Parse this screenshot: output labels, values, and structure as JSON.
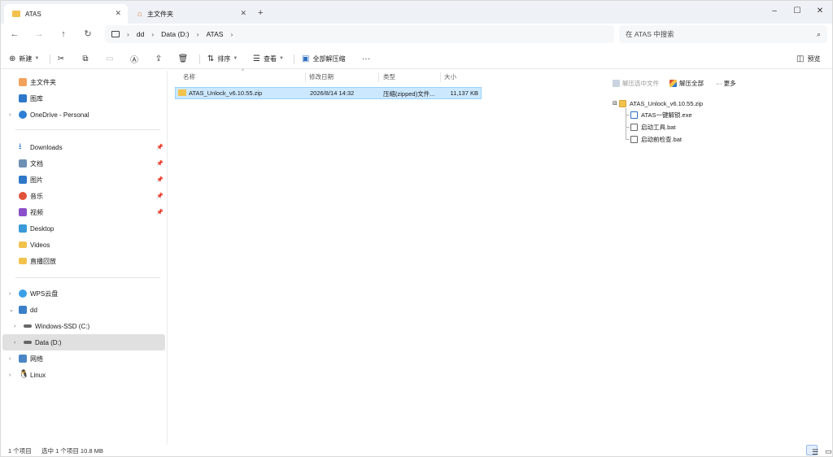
{
  "tabs": [
    {
      "label": "ATAS",
      "icon": "folder-icon",
      "active": true
    },
    {
      "label": "主文件夹",
      "icon": "home-icon",
      "active": false
    }
  ],
  "window_controls": {
    "minimize": "–",
    "maximize": "☐",
    "close": "✕"
  },
  "nav": {
    "back": "←",
    "forward": "→",
    "up": "↑",
    "refresh": "↻"
  },
  "breadcrumb": [
    "dd",
    "Data (D:)",
    "ATAS"
  ],
  "search": {
    "placeholder": "在 ATAS 中搜索"
  },
  "toolbar": {
    "new_label": "新建",
    "sort_label": "排序",
    "view_label": "查看",
    "extract_all_label": "全部解压缩",
    "more_label": "···",
    "preview_label": "预览"
  },
  "sidebar": {
    "items": [
      {
        "label": "主文件夹",
        "icon": "home-icon"
      },
      {
        "label": "图库",
        "icon": "gallery-icon"
      },
      {
        "label": "OneDrive - Personal",
        "icon": "cloud-icon"
      },
      {
        "label": "Downloads",
        "icon": "download-icon"
      },
      {
        "label": "文档",
        "icon": "document-icon"
      },
      {
        "label": "图片",
        "icon": "picture-icon"
      },
      {
        "label": "音乐",
        "icon": "music-icon"
      },
      {
        "label": "视频",
        "icon": "video-icon"
      },
      {
        "label": "Desktop",
        "icon": "desktop-icon"
      },
      {
        "label": "Videos",
        "icon": "folder-icon"
      },
      {
        "label": "直播回放",
        "icon": "folder-icon"
      },
      {
        "label": "WPS云盘",
        "icon": "cloud-icon"
      },
      {
        "label": "dd",
        "icon": "pc-icon"
      },
      {
        "label": "Windows-SSD (C:)",
        "icon": "drive-icon"
      },
      {
        "label": "Data (D:)",
        "icon": "drive-icon"
      },
      {
        "label": "网络",
        "icon": "network-icon"
      },
      {
        "label": "Linux",
        "icon": "linux-icon"
      }
    ]
  },
  "columns": [
    "名称",
    "修改日期",
    "类型",
    "大小"
  ],
  "files": [
    {
      "name": "ATAS_Unlock_v6.10.55.zip",
      "modified": "2026/8/14 14:32",
      "type": "压缩(zipped)文件...",
      "size": "11,137 KB"
    }
  ],
  "preview": {
    "extract_selected": "解压选中文件",
    "extract_all": "解压全部",
    "more": "··· 更多",
    "root": "ATAS_Unlock_v6.10.55.zip",
    "children": [
      "ATAS一键解锁.exe",
      "启动工具.bat",
      "启动前检查.bat"
    ]
  },
  "status": {
    "count": "1 个项目",
    "selected": "选中 1 个项目  10.8 MB"
  },
  "colors": {
    "accent": "#0067c0",
    "selection_bg": "#cce8ff",
    "folder": "#f2c24c"
  }
}
